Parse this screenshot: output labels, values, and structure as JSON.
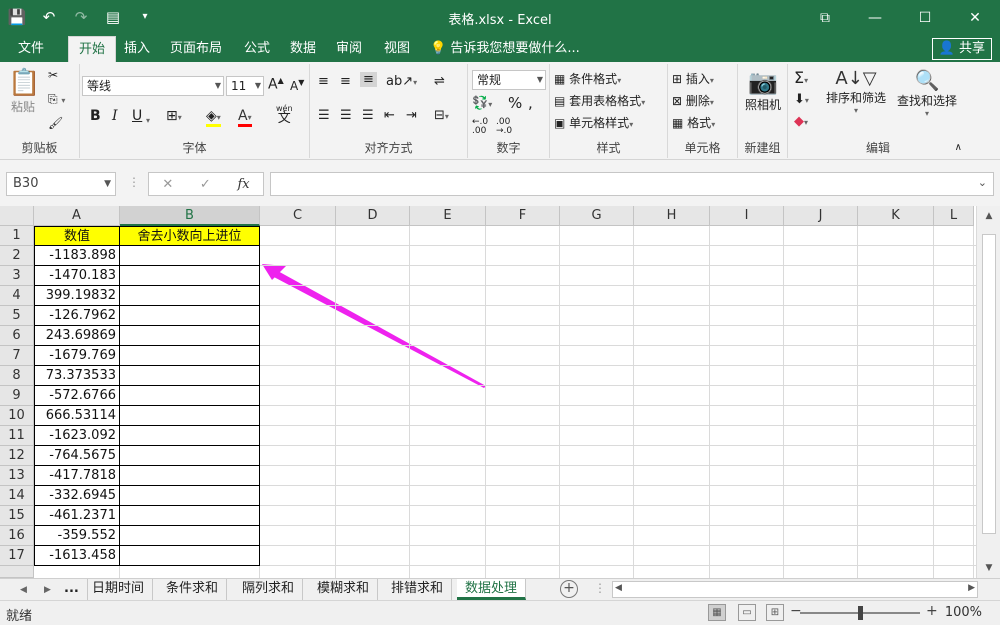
{
  "window": {
    "title": "表格.xlsx - Excel"
  },
  "menu": {
    "tabs": [
      "文件",
      "开始",
      "插入",
      "页面布局",
      "公式",
      "数据",
      "审阅",
      "视图"
    ],
    "active_tab": "开始",
    "tell_me": "告诉我您想要做什么...",
    "share": "共享"
  },
  "ribbon": {
    "clipboard": {
      "label": "剪贴板",
      "paste": "粘贴"
    },
    "font": {
      "label": "字体",
      "font_name": "等线",
      "font_size": "11",
      "bold": "B",
      "italic": "I",
      "underline": "U",
      "wen": "wén",
      "wen_char": "文"
    },
    "alignment": {
      "label": "对齐方式"
    },
    "number": {
      "label": "数字",
      "format": "常规"
    },
    "styles": {
      "label": "样式",
      "conditional": "条件格式",
      "table": "套用表格格式",
      "cell": "单元格样式"
    },
    "cells": {
      "label": "单元格",
      "insert": "插入",
      "delete": "删除",
      "format": "格式"
    },
    "camera": {
      "label": "新建组",
      "name": "照相机"
    },
    "editing": {
      "label": "编辑",
      "sort": "排序和筛选",
      "find": "查找和选择"
    }
  },
  "formula_bar": {
    "name_box": "B30",
    "fx": "fx",
    "value": ""
  },
  "grid": {
    "columns": [
      "A",
      "B",
      "C",
      "D",
      "E",
      "F",
      "G",
      "H",
      "I",
      "J",
      "K",
      "L"
    ],
    "selected_column": "B",
    "rows": [
      "1",
      "2",
      "3",
      "4",
      "5",
      "6",
      "7",
      "8",
      "9",
      "10",
      "11",
      "12",
      "13",
      "14",
      "15",
      "16",
      "17"
    ],
    "header_a": "数值",
    "header_b": "舍去小数向上进位",
    "values": [
      "-1183.898",
      "-1470.183",
      "399.19832",
      "-126.7962",
      "243.69869",
      "-1679.769",
      "73.373533",
      "-572.6766",
      "666.53114",
      "-1623.092",
      "-764.5675",
      "-417.7818",
      "-332.6945",
      "-461.2371",
      "-359.552",
      "-1613.458"
    ],
    "arrow_color": "#ee22ee",
    "header_fill": "#ffff00"
  },
  "sheets": {
    "ellipsis": "...",
    "tabs": [
      "日期时间",
      "条件求和",
      "隔列求和",
      "模糊求和",
      "排错求和",
      "数据处理"
    ],
    "active": "数据处理"
  },
  "status": {
    "text": "就绪",
    "zoom": "100%",
    "zoom_level": 100
  },
  "colors": {
    "accent": "#217346"
  }
}
